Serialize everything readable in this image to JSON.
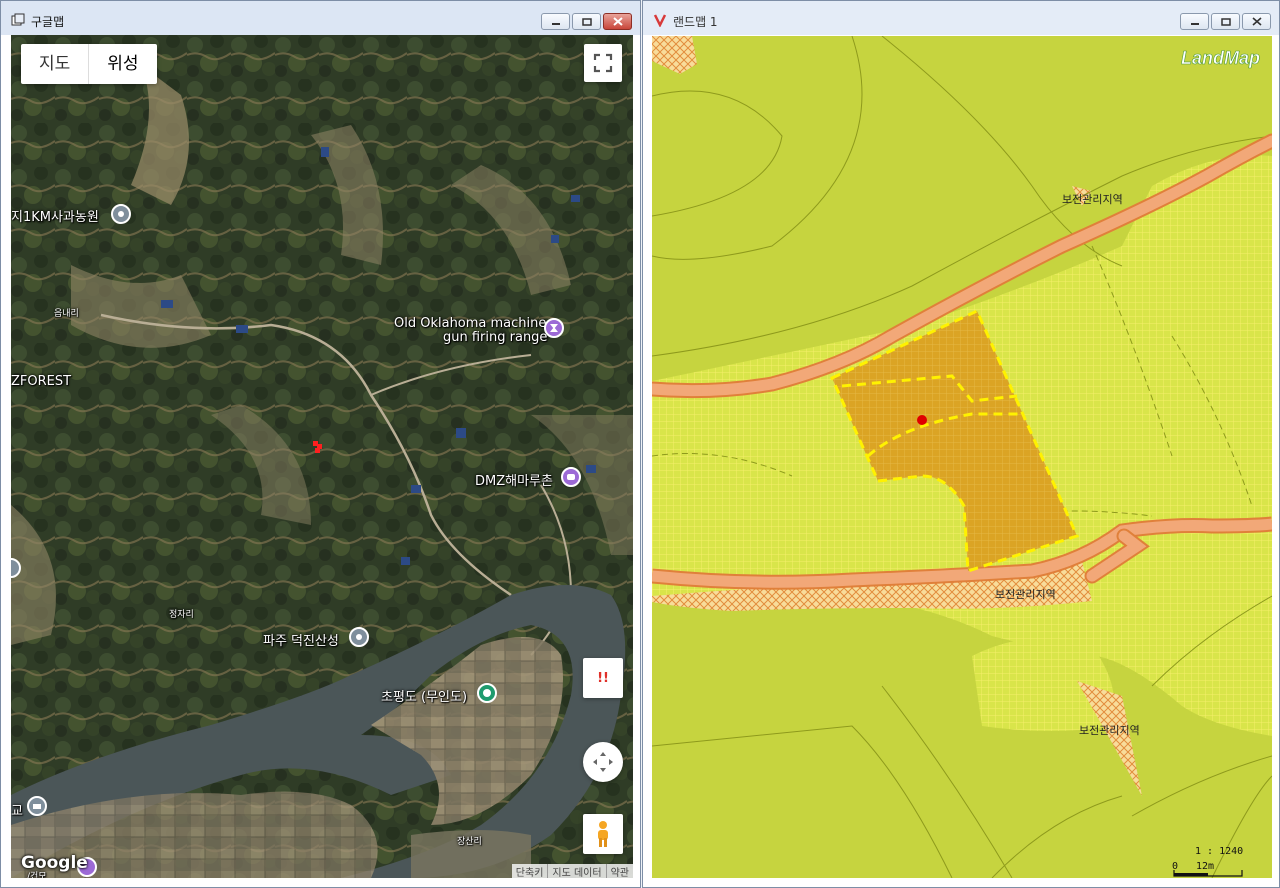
{
  "left_window": {
    "title": "구글맵",
    "map_type_buttons": [
      "지도",
      "위성"
    ],
    "pois": [
      {
        "label": "지1KM사과농원"
      },
      {
        "label": "읍내리"
      },
      {
        "label": "Old Oklahoma machine"
      },
      {
        "label": "gun firing range"
      },
      {
        "label": "ZFOREST"
      },
      {
        "label": "DMZ해마루촌"
      },
      {
        "label": "정자리"
      },
      {
        "label": "파주 덕진산성"
      },
      {
        "label": "초평도 (무인도)"
      },
      {
        "label": "교"
      },
      {
        "label": "장산리"
      },
      {
        "label": "/건모"
      }
    ],
    "logo": "Google",
    "attribution": [
      "단축키",
      "지도 데이터",
      "약관"
    ],
    "alert_label": "!!"
  },
  "right_window": {
    "title": "랜드맵 1",
    "logo": "LandMap",
    "zone_labels": [
      "보전관리지역",
      "보전관리지역",
      "보전관리지역"
    ],
    "scale_ratio": "1 : 1240",
    "scale_start": "0",
    "scale_end": "12m"
  },
  "colors": {
    "landmap_base": "#c6d43f",
    "road": "#f0a060",
    "parcel": "#dba424",
    "boundary": "#fff200",
    "marker": "#e00000"
  }
}
